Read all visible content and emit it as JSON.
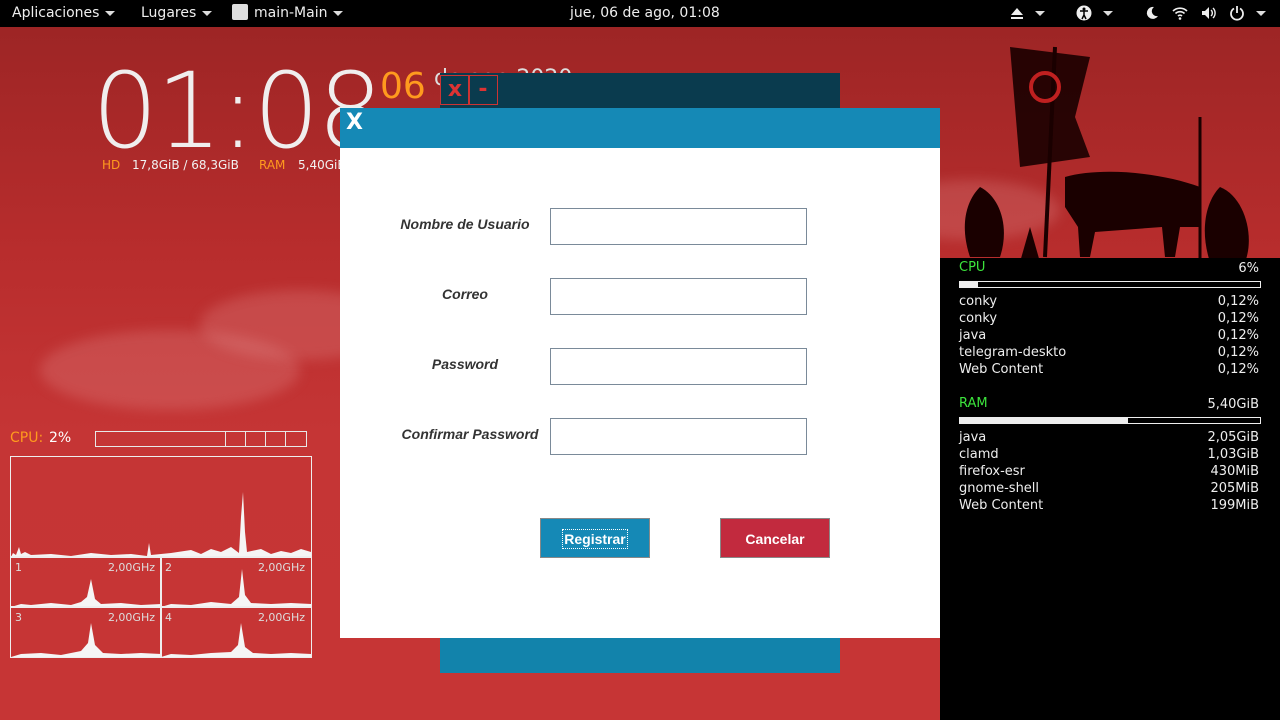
{
  "topbar": {
    "apps_label": "Aplicaciones",
    "places_label": "Lugares",
    "window_label": "main-Main",
    "datetime": "jue, 06 de ago, 01:08"
  },
  "desktop": {
    "clock": "01:08",
    "date_day": "06",
    "date_rest": "de ago 2020",
    "hd_label": "HD",
    "hd_value": "17,8GiB / 68,3GiB",
    "ram_label": "RAM",
    "ram_value": "5,40GiB",
    "cpu_label": "CPU:",
    "cpu_value": "2%",
    "cores": [
      {
        "num": "1",
        "freq": "2,00GHz"
      },
      {
        "num": "2",
        "freq": "2,00GHz"
      },
      {
        "num": "3",
        "freq": "2,00GHz"
      },
      {
        "num": "4",
        "freq": "2,00GHz"
      }
    ]
  },
  "conky": {
    "cpu_label": "CPU",
    "cpu_value": "6%",
    "cpu_fraction": 0.06,
    "cpu_procs": [
      {
        "name": "conky",
        "value": "0,12%"
      },
      {
        "name": "conky",
        "value": "0,12%"
      },
      {
        "name": "java",
        "value": "0,12%"
      },
      {
        "name": "telegram-deskto",
        "value": "0,12%"
      },
      {
        "name": "Web Content",
        "value": "0,12%"
      }
    ],
    "ram_label": "RAM",
    "ram_value": "5,40GiB",
    "ram_fraction": 0.56,
    "ram_procs": [
      {
        "name": "java",
        "value": "2,05GiB"
      },
      {
        "name": "clamd",
        "value": "1,03GiB"
      },
      {
        "name": "firefox-esr",
        "value": "430MiB"
      },
      {
        "name": "gnome-shell",
        "value": "205MiB"
      },
      {
        "name": "Web Content",
        "value": "199MiB"
      }
    ]
  },
  "bg_window": {
    "close_label": "x",
    "min_label": "-"
  },
  "dialog": {
    "close_label": "X",
    "fields": [
      {
        "label": "Nombre de Usuario",
        "value": ""
      },
      {
        "label": "Correo",
        "value": ""
      },
      {
        "label": "Password",
        "value": ""
      },
      {
        "label": "Confirmar Password",
        "value": ""
      }
    ],
    "register_label": "Registrar",
    "cancel_label": "Cancelar"
  },
  "colors": {
    "accent_blue": "#1589b6",
    "cancel_red": "#c22a3e",
    "conky_green": "#3ce33c",
    "conky_orange": "#ff9a1e"
  }
}
